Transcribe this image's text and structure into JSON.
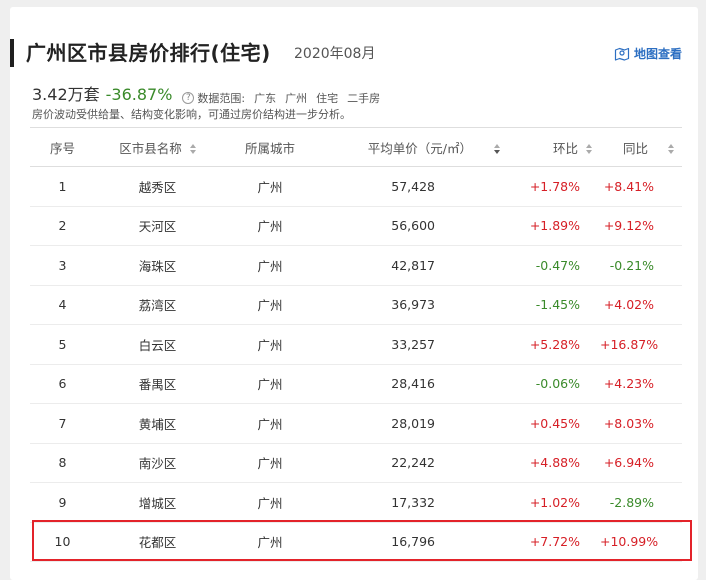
{
  "header": {
    "title": "广州区市县房价排行(住宅)",
    "date": "2020年08月",
    "map_link_label": "地图查看"
  },
  "summary": {
    "count": "3.42万套",
    "change": "-36.87%",
    "scope_label": "数据范围:",
    "scope_items": [
      "广东",
      "广州",
      "住宅",
      "二手房"
    ],
    "note": "房价波动受供给量、结构变化影响，可通过房价结构进一步分析。"
  },
  "table": {
    "columns": [
      "序号",
      "区市县名称",
      "所属城市",
      "平均单价（元/㎡）",
      "环比",
      "同比"
    ],
    "rows": [
      {
        "rank": "1",
        "district": "越秀区",
        "city": "广州",
        "price": "57,428",
        "mom": "+1.78%",
        "yoy": "+8.41%"
      },
      {
        "rank": "2",
        "district": "天河区",
        "city": "广州",
        "price": "56,600",
        "mom": "+1.89%",
        "yoy": "+9.12%"
      },
      {
        "rank": "3",
        "district": "海珠区",
        "city": "广州",
        "price": "42,817",
        "mom": "-0.47%",
        "yoy": "-0.21%"
      },
      {
        "rank": "4",
        "district": "荔湾区",
        "city": "广州",
        "price": "36,973",
        "mom": "-1.45%",
        "yoy": "+4.02%"
      },
      {
        "rank": "5",
        "district": "白云区",
        "city": "广州",
        "price": "33,257",
        "mom": "+5.28%",
        "yoy": "+16.87%"
      },
      {
        "rank": "6",
        "district": "番禺区",
        "city": "广州",
        "price": "28,416",
        "mom": "-0.06%",
        "yoy": "+4.23%"
      },
      {
        "rank": "7",
        "district": "黄埔区",
        "city": "广州",
        "price": "28,019",
        "mom": "+0.45%",
        "yoy": "+8.03%"
      },
      {
        "rank": "8",
        "district": "南沙区",
        "city": "广州",
        "price": "22,242",
        "mom": "+4.88%",
        "yoy": "+6.94%"
      },
      {
        "rank": "9",
        "district": "增城区",
        "city": "广州",
        "price": "17,332",
        "mom": "+1.02%",
        "yoy": "-2.89%"
      },
      {
        "rank": "10",
        "district": "花都区",
        "city": "广州",
        "price": "16,796",
        "mom": "+7.72%",
        "yoy": "+10.99%"
      }
    ]
  },
  "colors": {
    "positive": "#d61f26",
    "negative": "#3a8a2a",
    "highlight": "#e3232a",
    "link": "#2d6fc2"
  },
  "icons": {
    "map_link": "map-pin-icon",
    "scope_help": "question-circle-icon",
    "sort": "sort-arrows-icon"
  }
}
